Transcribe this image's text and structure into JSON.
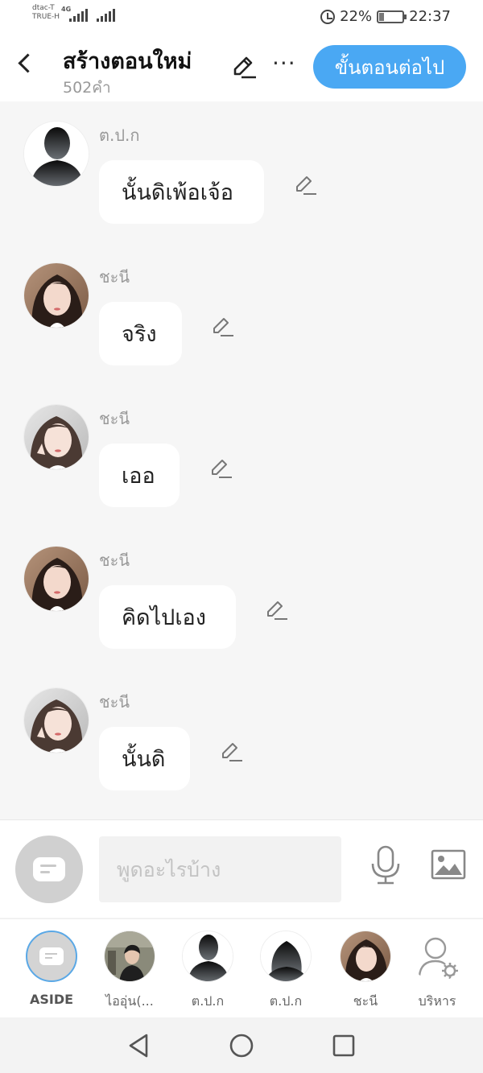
{
  "status_bar": {
    "carrier_1": "dtac-T",
    "carrier_2": "TRUE-H",
    "network": "4G",
    "battery_percent": "22%",
    "battery_level": 0.22,
    "time": "22:37",
    "icons": [
      "alarm-icon",
      "battery-icon",
      "signal-icon"
    ]
  },
  "header": {
    "title": "สร้างตอนใหม่",
    "word_count": "502คำ",
    "more_label": "···",
    "next_button": "ขั้นตอนต่อไป",
    "accent_color": "#4aa8f3"
  },
  "messages": [
    {
      "sender": "ต.ป.ก",
      "text": "นั้นดิเพ้อเจ้อ",
      "avatar": "silhouette-man"
    },
    {
      "sender": "ชะนี",
      "text": "จริง",
      "avatar": "girl-photo"
    },
    {
      "sender": "ชะนี",
      "text": "เออ",
      "avatar": "girl-photo-2"
    },
    {
      "sender": "ชะนี",
      "text": "คิดไปเอง",
      "avatar": "girl-photo"
    },
    {
      "sender": "ชะนี",
      "text": "นั้นดิ",
      "avatar": "girl-photo-2"
    }
  ],
  "composer": {
    "placeholder": "พูดอะไรบ้าง",
    "value": ""
  },
  "characters": [
    {
      "label": "ASIDE",
      "type": "aside"
    },
    {
      "label": "ไออุ่น(...",
      "type": "boy-photo"
    },
    {
      "label": "ต.ป.ก",
      "type": "silhouette-man"
    },
    {
      "label": "ต.ป.ก",
      "type": "silhouette-woman"
    },
    {
      "label": "ชะนี",
      "type": "girl-photo"
    },
    {
      "label": "บริหาร",
      "type": "manage"
    }
  ]
}
